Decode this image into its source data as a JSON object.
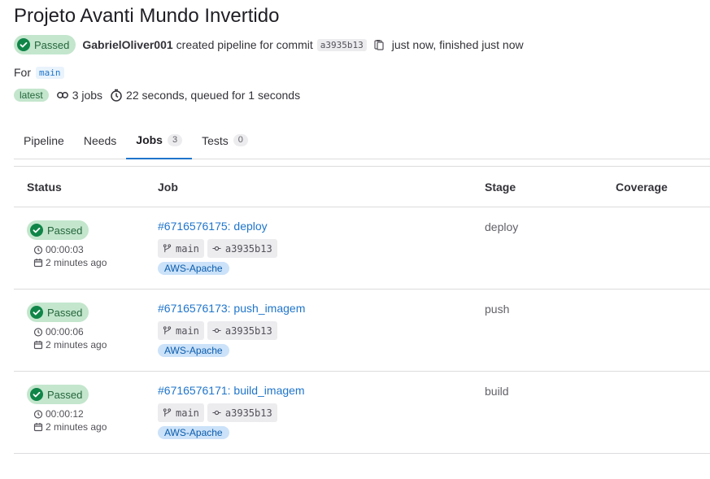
{
  "title": "Projeto Avanti Mundo Invertido",
  "pipeline": {
    "status": "Passed",
    "author": "GabrielOliver001",
    "created_text": "created pipeline for commit",
    "commit_sha": "a3935b13",
    "time_text": "just now, finished just now",
    "for_label": "For",
    "ref": "main",
    "latest_label": "latest",
    "jobs_count_text": "3 jobs",
    "duration_text": "22 seconds, queued for 1 seconds"
  },
  "tabs": [
    {
      "label": "Pipeline",
      "count": null
    },
    {
      "label": "Needs",
      "count": null
    },
    {
      "label": "Jobs",
      "count": "3"
    },
    {
      "label": "Tests",
      "count": "0"
    }
  ],
  "table": {
    "headers": {
      "status": "Status",
      "job": "Job",
      "stage": "Stage",
      "coverage": "Coverage"
    },
    "rows": [
      {
        "status": "Passed",
        "duration": "00:00:03",
        "finished": "2 minutes ago",
        "job": "#6716576175: deploy",
        "branch": "main",
        "sha": "a3935b13",
        "tag": "AWS-Apache",
        "stage": "deploy"
      },
      {
        "status": "Passed",
        "duration": "00:00:06",
        "finished": "2 minutes ago",
        "job": "#6716576173: push_imagem",
        "branch": "main",
        "sha": "a3935b13",
        "tag": "AWS-Apache",
        "stage": "push"
      },
      {
        "status": "Passed",
        "duration": "00:00:12",
        "finished": "2 minutes ago",
        "job": "#6716576171: build_imagem",
        "branch": "main",
        "sha": "a3935b13",
        "tag": "AWS-Apache",
        "stage": "build"
      }
    ]
  },
  "colors": {
    "success": "#108548",
    "success_bg": "#c3e6cd",
    "link": "#1f75cb",
    "tag_bg": "#cbe2f9"
  },
  "icons": [
    "status-success-icon",
    "copy-icon",
    "pipeline-jobs-icon",
    "clock-icon",
    "calendar-icon",
    "branch-icon",
    "commit-icon"
  ]
}
